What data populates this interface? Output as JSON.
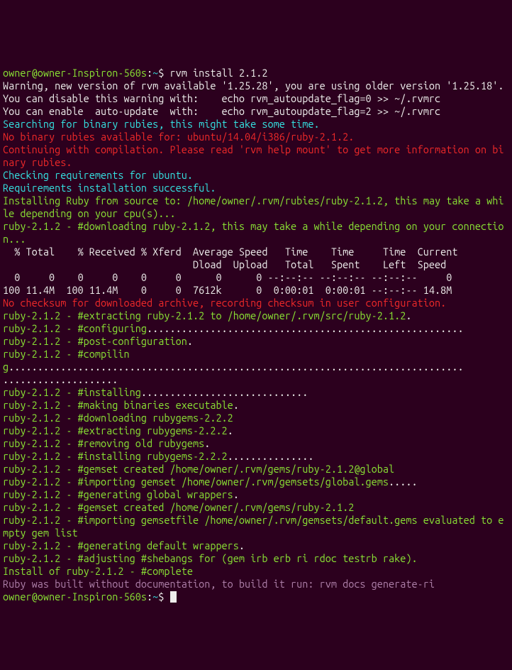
{
  "prompt1_user": "owner@owner-Inspiron-560s",
  "prompt1_path": "~",
  "prompt1_cmd": "rvm install 2.1.2",
  "warn_line1": "Warning, new version of rvm available '1.25.28', you are using older version '1.25.18'.",
  "warn_line2": "You can disable this warning with:    echo rvm_autoupdate_flag=0 >> ~/.rvmrc",
  "warn_line3": "You can enable  auto-update  with:    echo rvm_autoupdate_flag=2 >> ~/.rvmrc",
  "search": "Searching for binary rubies, this might take some time.",
  "nobinary": "No binary rubies available for: ubuntu/14.04/i386/ruby-2.1.2.",
  "continue": "Continuing with compilation. Please read 'rvm help mount' to get more information on binary rubies.",
  "checkreq": "Checking requirements for ubuntu.",
  "reqok": "Requirements installation successful.",
  "install_from_src": "Installing Ruby from source to: /home/owner/.rvm/rubies/ruby-2.1.2, this may take a while depending on your cpu(s)...",
  "download": "ruby-2.1.2 - #downloading ruby-2.1.2, this may take a while depending on your connection...",
  "curl_hdr": "  % Total    % Received % Xferd  Average Speed   Time    Time     Time  Current",
  "curl_hdr2": "                                 Dload  Upload   Total   Spent    Left  Speed",
  "curl_row1": "  0     0    0     0    0     0      0      0 --:--:-- --:--:-- --:--:--     0",
  "curl_row2": "100 11.4M  100 11.4M    0     0  7612k      0  0:00:01  0:00:01 --:--:-- 14.8M",
  "nochecksum": "No checksum for downloaded archive, recording checksum in user configuration.",
  "extracting": "ruby-2.1.2 - #extracting ruby-2.1.2 to /home/owner/.rvm/src/ruby-2.1.2",
  "configuring": "ruby-2.1.2 - #configuring",
  "config_dots": ".......................................................",
  "postconfig": "ruby-2.1.2 - #post-configuration",
  "compiling": "ruby-2.1.2 - #compiling",
  "compile_dots": "...............................................................................",
  "compile_dots2": "....................",
  "installing": "ruby-2.1.2 - #installing",
  "install_dots": ".............................",
  "makebin": "ruby-2.1.2 - #making binaries executable",
  "dlgems": "ruby-2.1.2 - #downloading rubygems-2.2.2",
  "exgems": "ruby-2.1.2 - #extracting rubygems-2.2.2",
  "rmgems": "ruby-2.1.2 - #removing old rubygems",
  "instgems": "ruby-2.1.2 - #installing rubygems-2.2.2",
  "instgems_dots": "...............",
  "gemset1": "ruby-2.1.2 - #gemset created /home/owner/.rvm/gems/ruby-2.1.2@global",
  "impgem": "ruby-2.1.2 - #importing gemset /home/owner/.rvm/gemsets/global.gems",
  "impgem_dots": ".....",
  "genwrap": "ruby-2.1.2 - #generating global wrappers",
  "gemset2": "ruby-2.1.2 - #gemset created /home/owner/.rvm/gems/ruby-2.1.2",
  "impgemfile": "ruby-2.1.2 - #importing gemsetfile /home/owner/.rvm/gemsets/default.gems evaluated to empty gem list",
  "gendefwrap": "ruby-2.1.2 - #generating default wrappers",
  "adjshebang": "ruby-2.1.2 - #adjusting #shebangs for (gem irb erb ri rdoc testrb rake).",
  "complete": "Install of ruby-2.1.2 - #complete ",
  "nodocs": "Ruby was built without documentation, to build it run: rvm docs generate-ri",
  "prompt2_user": "owner@owner-Inspiron-560s",
  "prompt2_path": "~",
  "dot": ".",
  "dollar": "$",
  "colon": ":"
}
